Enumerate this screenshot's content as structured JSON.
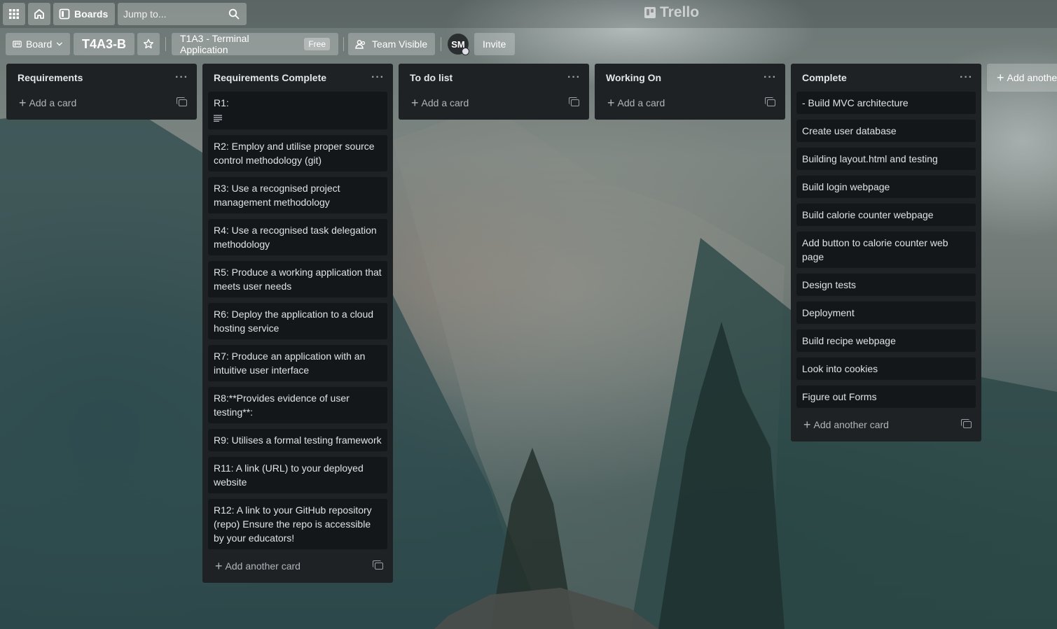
{
  "topbar": {
    "boards_label": "Boards",
    "search_placeholder": "Jump to...",
    "logo_text": "Trello"
  },
  "board_header": {
    "view_label": "Board",
    "board_name": "T4A3-B",
    "team_name": "T1A3 - Terminal Application",
    "team_plan": "Free",
    "visibility": "Team Visible",
    "avatar_initials": "SM",
    "invite_label": "Invite"
  },
  "lists": [
    {
      "title": "Requirements",
      "cards": [],
      "add_label": "Add a card"
    },
    {
      "title": "Requirements Complete",
      "cards": [
        "R1:",
        "R2: Employ and utilise proper source control methodology (git)",
        "R3: Use a recognised project management methodology",
        "R4: Use a recognised task delegation methodology",
        "R5: Produce a working application that meets user needs",
        "R6: Deploy the application to a cloud hosting service",
        "R7: Produce an application with an intuitive user interface",
        "R8:**Provides evidence of user testing**:",
        "R9: Utilises a formal testing framework",
        "R11: A link (URL) to your deployed website",
        "R12: A link to your GitHub repository (repo) Ensure the repo is accessible by your educators!"
      ],
      "add_label": "Add another card"
    },
    {
      "title": "To do list",
      "cards": [],
      "add_label": "Add a card"
    },
    {
      "title": "Working On",
      "cards": [],
      "add_label": "Add a card"
    },
    {
      "title": "Complete",
      "cards": [
        "- Build MVC architecture",
        "Create user database",
        "Building layout.html and testing",
        "Build login webpage",
        "Build calorie counter webpage",
        "Add button to calorie counter web page",
        "Design tests",
        "Deployment",
        "Build recipe webpage",
        "Look into cookies",
        "Figure out Forms"
      ],
      "add_label": "Add another card"
    }
  ],
  "add_list_label": "Add another list",
  "colors": {
    "list_bg": "#1e2224",
    "card_bg": "#141719",
    "text": "#e0e2e4"
  }
}
